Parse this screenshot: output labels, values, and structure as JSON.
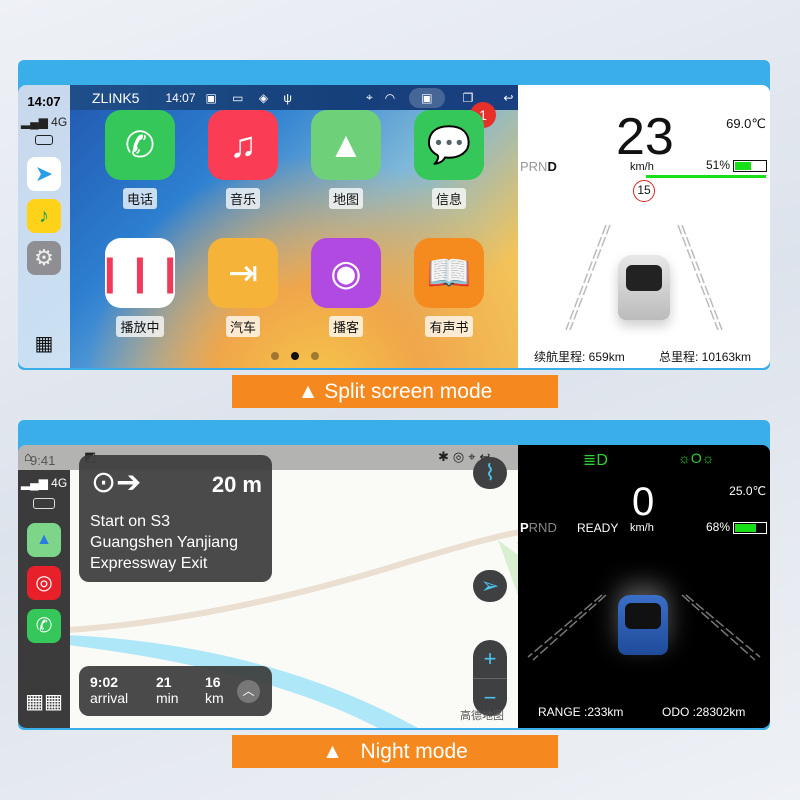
{
  "split": {
    "carplay": {
      "sidebar_time": "14:07",
      "signal": "4G",
      "status_title": "ZLINK5",
      "status_time": "14:07",
      "badge": "1",
      "apps": [
        {
          "label": "电话",
          "icon": "phone-icon",
          "color": "#35c759"
        },
        {
          "label": "音乐",
          "icon": "music-icon",
          "color": "#fa3d55"
        },
        {
          "label": "地图",
          "icon": "maps-icon",
          "color": "#6fd07a"
        },
        {
          "label": "信息",
          "icon": "messages-icon",
          "color": "#35c759"
        },
        {
          "label": "播放中",
          "icon": "now-playing-icon",
          "color": "#ffffff"
        },
        {
          "label": "汽车",
          "icon": "car-exit-icon",
          "color": "#f5b33a"
        },
        {
          "label": "播客",
          "icon": "podcast-icon",
          "color": "#b04ae0"
        },
        {
          "label": "有声书",
          "icon": "book-icon",
          "color": "#f58a1f"
        }
      ],
      "page": 2,
      "pages": 3
    },
    "cluster": {
      "speed": "23",
      "unit": "km/h",
      "gear": "PRND",
      "active_gear": "D",
      "temp": "69.0℃",
      "battery": "51%",
      "battery_level": 51,
      "speed_limit": "15",
      "range": "续航里程: 659km",
      "odo": "总里程: 10163km"
    },
    "label": "▲ Split screen mode"
  },
  "night": {
    "carplay": {
      "sidebar_time": "9:41",
      "signal": "4G",
      "distance": "20 m",
      "instruction": [
        "Start on S3",
        "Guangshen Yanjiang",
        "Expressway Exit"
      ],
      "eta": [
        {
          "value": "9:02",
          "unit": "arrival"
        },
        {
          "value": "21",
          "unit": "min"
        },
        {
          "value": "16",
          "unit": "km"
        }
      ],
      "map_logo": "高德地图"
    },
    "cluster": {
      "speed": "0",
      "unit": "km/h",
      "gear": "PRND",
      "active_gear": "P",
      "ready": "READY",
      "temp": "25.0℃",
      "battery": "68%",
      "battery_level": 68,
      "range": "RANGE :233km",
      "odo": "ODO :28302km",
      "indicator_color": "#2fd02f"
    },
    "label": "▲   Night mode"
  },
  "colors": {
    "accent": "#3aaee8",
    "button": "#f5891f"
  }
}
